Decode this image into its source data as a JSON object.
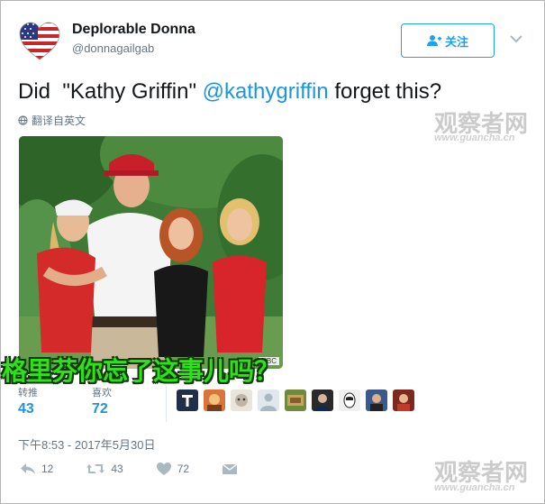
{
  "user": {
    "display_name": "Deplorable Donna",
    "handle": "@donnagailgab"
  },
  "follow_button": {
    "label": "关注",
    "icon": "follow-person-icon"
  },
  "tweet": {
    "text_before": "Did  \"Kathy Griffin\" ",
    "mention": "@kathygriffin",
    "text_after": " forget this?",
    "translate_label": "翻译自英文",
    "photo_credit": "NBC"
  },
  "overlay_caption": "格里芬你忘了这事儿吗？",
  "stats": {
    "retweets_label": "转推",
    "retweets_value": "43",
    "likes_label": "喜欢",
    "likes_value": "72"
  },
  "timestamp": "下午8:53 - 2017年5月30日",
  "actions": {
    "reply_count": "12",
    "retweet_count": "43",
    "like_count": "72"
  },
  "watermark": {
    "title": "观察者网",
    "url": "www.guancha.cn"
  },
  "colors": {
    "link": "#1b95e0",
    "follow": "#1da1f2",
    "caption": "#2fe01a",
    "secondary": "#657786"
  }
}
